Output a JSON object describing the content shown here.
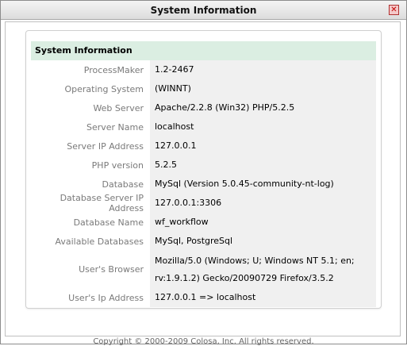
{
  "window": {
    "title": "System Information",
    "close_glyph": "✕"
  },
  "panel": {
    "heading": "System Information",
    "rows": [
      {
        "label": "ProcessMaker",
        "value": "1.2-2467"
      },
      {
        "label": "Operating System",
        "value": "(WINNT)"
      },
      {
        "label": "Web Server",
        "value": "Apache/2.2.8 (Win32) PHP/5.2.5"
      },
      {
        "label": "Server Name",
        "value": "localhost"
      },
      {
        "label": "Server IP Address",
        "value": "127.0.0.1"
      },
      {
        "label": "PHP version",
        "value": "5.2.5"
      },
      {
        "label": "Database",
        "value": "MySql (Version 5.0.45-community-nt-log)"
      },
      {
        "label": "Database Server IP Address",
        "value": "127.0.0.1:3306"
      },
      {
        "label": "Database Name",
        "value": "wf_workflow"
      },
      {
        "label": "Available Databases",
        "value": "MySql, PostgreSql"
      },
      {
        "label": "User's Browser",
        "value": "Mozilla/5.0 (Windows; U; Windows NT 5.1; en; rv:1.9.1.2) Gecko/20090729 Firefox/3.5.2"
      },
      {
        "label": "User's Ip Address",
        "value": "127.0.0.1 => localhost"
      }
    ]
  },
  "footer": {
    "copyright": "Copyright © 2000-2009 Colosa, Inc. All rights reserved."
  }
}
